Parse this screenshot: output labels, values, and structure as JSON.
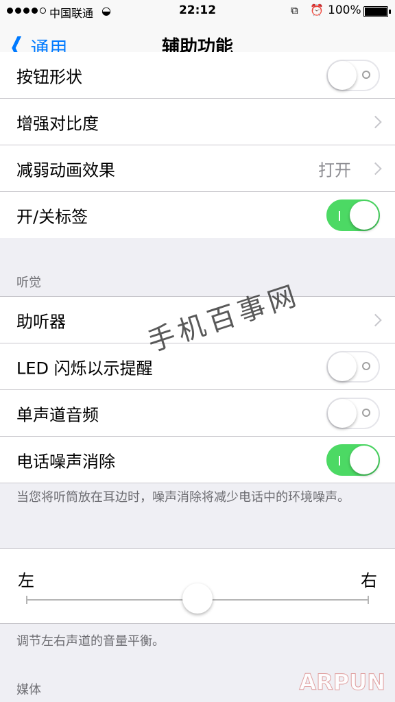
{
  "status_bar": {
    "carrier": "中国联通",
    "time": "22:12",
    "battery_percent": "100%"
  },
  "nav": {
    "back_label": "通用",
    "title": "辅助功能"
  },
  "group_top": [
    {
      "label": "按钮形状",
      "type": "toggle",
      "on": false
    },
    {
      "label": "增强对比度",
      "type": "chevron"
    },
    {
      "label": "减弱动画效果",
      "type": "chevron",
      "value": "打开"
    },
    {
      "label": "开/关标签",
      "type": "toggle",
      "on": true
    }
  ],
  "hearing": {
    "header": "听觉",
    "items": [
      {
        "label": "助听器",
        "type": "chevron"
      },
      {
        "label": "LED 闪烁以示提醒",
        "type": "toggle",
        "on": false
      },
      {
        "label": "单声道音频",
        "type": "toggle",
        "on": false
      },
      {
        "label": "电话噪声消除",
        "type": "toggle",
        "on": true
      }
    ],
    "footer": "当您将听筒放在耳边时，噪声消除将减少电话中的环境噪声。"
  },
  "balance": {
    "left_label": "左",
    "right_label": "右",
    "value": 0.5,
    "footer": "调节左右声道的音量平衡。"
  },
  "media_header": "媒体",
  "watermark": "手机百事网",
  "brand": "ARPUN",
  "colors": {
    "accent": "#007aff",
    "toggle_on": "#4cd964",
    "background": "#efeff4"
  }
}
